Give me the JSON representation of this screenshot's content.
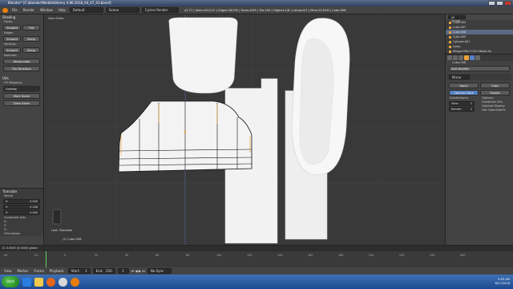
{
  "window": {
    "title": "Blender* [C:\\blender\\Modelle\\Henry 4.86.2018_A4_47_43.blend]"
  },
  "infobar": {
    "menus": [
      "File",
      "Render",
      "Window",
      "Help"
    ],
    "layout": "Default",
    "scene": "Scene",
    "engine": "Cycles Render",
    "stats": "v2.77 | Verts:101/111 | Edges:28/195 | Faces:0/95 | Tris:190 | Objects:1/8 | Lamps:0/1 | Mem:22.61M | Cube.008"
  },
  "toolshelf": {
    "shading_header": "Shading",
    "faces": "Faces:",
    "smooth": "Smooth",
    "flat": "Flat",
    "edges": "Edges:",
    "sharp": "Sharp",
    "vertices": "Vertices:",
    "normals": "Normals:",
    "recalculate": "Recalculate",
    "flip_direction": "Flip Direction",
    "uvs_header": "UVs",
    "uv_mapping": "UV Mapping:",
    "unwrap": "Unwrap",
    "mark_seam": "Mark Seam",
    "clear_seam": "Clear Seam",
    "translate_header": "Translate",
    "vector": "Vector",
    "x": "X:",
    "y": "Y:",
    "z": "Z:",
    "vx": "0.000",
    "vy": "0.166",
    "vz": "0.000",
    "constraint_axis": "Constraint Axis",
    "orientation": "Orientation"
  },
  "viewport": {
    "view_label": "User Ortho",
    "object_label": "(1) Cube.008",
    "last_op": "Last: Translate"
  },
  "outliner": {
    "search": "All Scenes",
    "items": [
      "Cube.004",
      "Cube.007",
      "Cube.008",
      "Cube.009",
      "Cylinder.001",
      "Lamp",
      "Mirage+Mio7+Dr+Model-Hn"
    ]
  },
  "props": {
    "object": "Cube.008",
    "add_modifier": "Add Modifier",
    "modifier": "Mirror",
    "apply": "Apply",
    "copy": "Copy",
    "catmull": "Catmull-Clark",
    "simple": "Simple",
    "subdivisions": "Subdivisions:",
    "view": "View:",
    "view_val": "2",
    "render": "Render:",
    "render_val": "2",
    "options": "Options:",
    "subdivide_uvs": "Subdivide UVs",
    "optimal": "Optimal Display",
    "opensubdiv": "Use OpenSubdiv"
  },
  "timeline": {
    "status": "D: 0.0000 (0.0000) global",
    "menus": [
      "View",
      "Marker",
      "Frame",
      "Playback"
    ],
    "start": "Start:",
    "start_val": "1",
    "end": "End:",
    "end_val": "250",
    "current": "1",
    "sync": "No Sync",
    "ticks": [
      "-40",
      "-20",
      "0",
      "20",
      "40",
      "60",
      "80",
      "100",
      "120",
      "140",
      "160",
      "180",
      "200",
      "220",
      "240",
      "260"
    ]
  },
  "taskbar": {
    "start": "Start",
    "time": "9:03 AM",
    "date": "6/27/2018"
  },
  "colors": {
    "accent": "#e8a23a",
    "selected": "#5680c2",
    "bg": "#393939"
  }
}
